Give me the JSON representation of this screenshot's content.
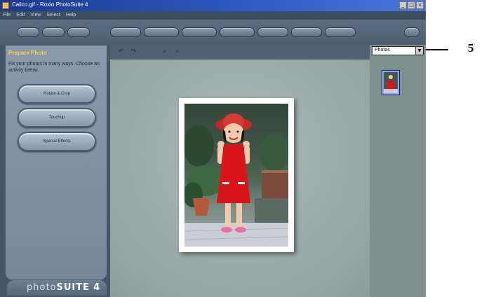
{
  "window": {
    "title": "Calico.gif - Roxio PhotoSuite 4",
    "controls": [
      "_",
      "□",
      "×"
    ]
  },
  "menu": [
    "File",
    "Edit",
    "View",
    "Select",
    "Help"
  ],
  "toolbar": {
    "nav_buttons": [
      "",
      "",
      ""
    ],
    "mode_buttons": [
      "",
      "",
      "",
      "",
      "",
      "",
      ""
    ]
  },
  "left_panel": {
    "title": "Prepare Photo",
    "description": "Fix your photos in many ways. Choose an activity below.",
    "buttons": [
      "Rotate & Crop",
      "Touchup",
      "Special Effects"
    ]
  },
  "brand": {
    "light": "photo",
    "bold": "SUITE",
    "version": "4"
  },
  "right_panel": {
    "dropdown_value": "Photos"
  },
  "callout": {
    "number": "5"
  }
}
